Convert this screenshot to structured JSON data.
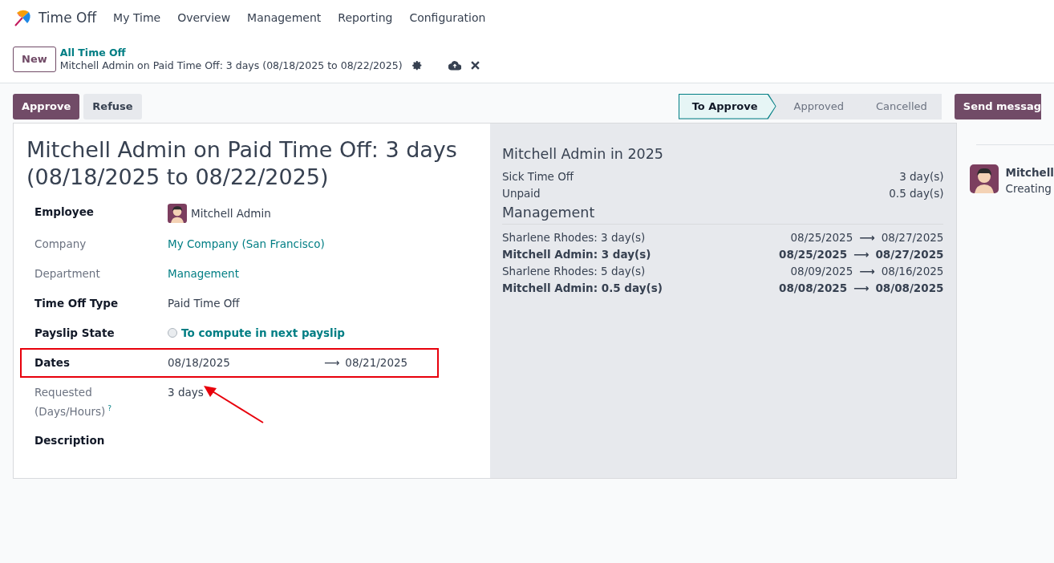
{
  "app": {
    "name": "Time Off",
    "menu": [
      "My Time",
      "Overview",
      "Management",
      "Reporting",
      "Configuration"
    ]
  },
  "control_panel": {
    "new_button": "New",
    "breadcrumb": "All Time Off",
    "record_title": "Mitchell Admin on Paid Time Off: 3 days (08/18/2025 to 08/22/2025)"
  },
  "actions": [
    "Approve",
    "Refuse"
  ],
  "statusbar": [
    {
      "label": "To Approve",
      "selected": true
    },
    {
      "label": "Approved",
      "selected": false
    },
    {
      "label": "Cancelled",
      "selected": false
    }
  ],
  "form": {
    "title": "Mitchell Admin on Paid Time Off: 3 days (08/18/2025 to 08/22/2025)",
    "fields": [
      {
        "label": "Employee",
        "required": true,
        "kind": "avatar",
        "value": "Mitchell Admin",
        "highlighted": false,
        "pointed": false
      },
      {
        "label": "Company",
        "required": false,
        "kind": "link",
        "value": "My Company (San Francisco)",
        "highlighted": false,
        "pointed": false
      },
      {
        "label": "Department",
        "required": false,
        "kind": "link",
        "value": "Management",
        "highlighted": false,
        "pointed": false
      },
      {
        "label": "Time Off Type",
        "required": true,
        "kind": "text",
        "value": "Paid Time Off",
        "highlighted": false,
        "pointed": false
      },
      {
        "label": "Payslip State",
        "required": true,
        "kind": "radio",
        "value": "To compute in next payslip",
        "highlighted": false,
        "pointed": false
      },
      {
        "label": "Dates",
        "required": true,
        "kind": "daterange",
        "value": "08/18/2025",
        "value_end": "08/21/2025",
        "arrow": "⟶",
        "highlighted": true,
        "pointed": false
      },
      {
        "label": "Requested (Days/Hours)",
        "help": "?",
        "required": false,
        "kind": "text",
        "value": "3 days",
        "highlighted": false,
        "pointed": true
      },
      {
        "label": "Description",
        "required": true,
        "kind": "empty",
        "highlighted": false,
        "pointed": false
      }
    ]
  },
  "side_panel": {
    "title": "Mitchell Admin in 2025",
    "allocations": [
      {
        "name": "Sick Time Off",
        "amount": "3 day(s)"
      },
      {
        "name": "Unpaid",
        "amount": "0.5 day(s)"
      }
    ],
    "department": "Management",
    "leaves": [
      {
        "name": "Sharlene Rhodes: 3 day(s)",
        "from": "08/25/2025",
        "to": "08/27/2025",
        "own": false
      },
      {
        "name": "Mitchell Admin: 3 day(s)",
        "from": "08/25/2025",
        "to": "08/27/2025",
        "own": true
      },
      {
        "name": "Sharlene Rhodes: 5 day(s)",
        "from": "08/09/2025",
        "to": "08/16/2025",
        "own": false
      },
      {
        "name": "Mitchell Admin: 0.5 day(s)",
        "from": "08/08/2025",
        "to": "08/08/2025",
        "own": true
      }
    ],
    "arrow": "⟶"
  },
  "chatter": {
    "send_button": "Send messag",
    "author": "Mitchell",
    "message": "Creating"
  }
}
